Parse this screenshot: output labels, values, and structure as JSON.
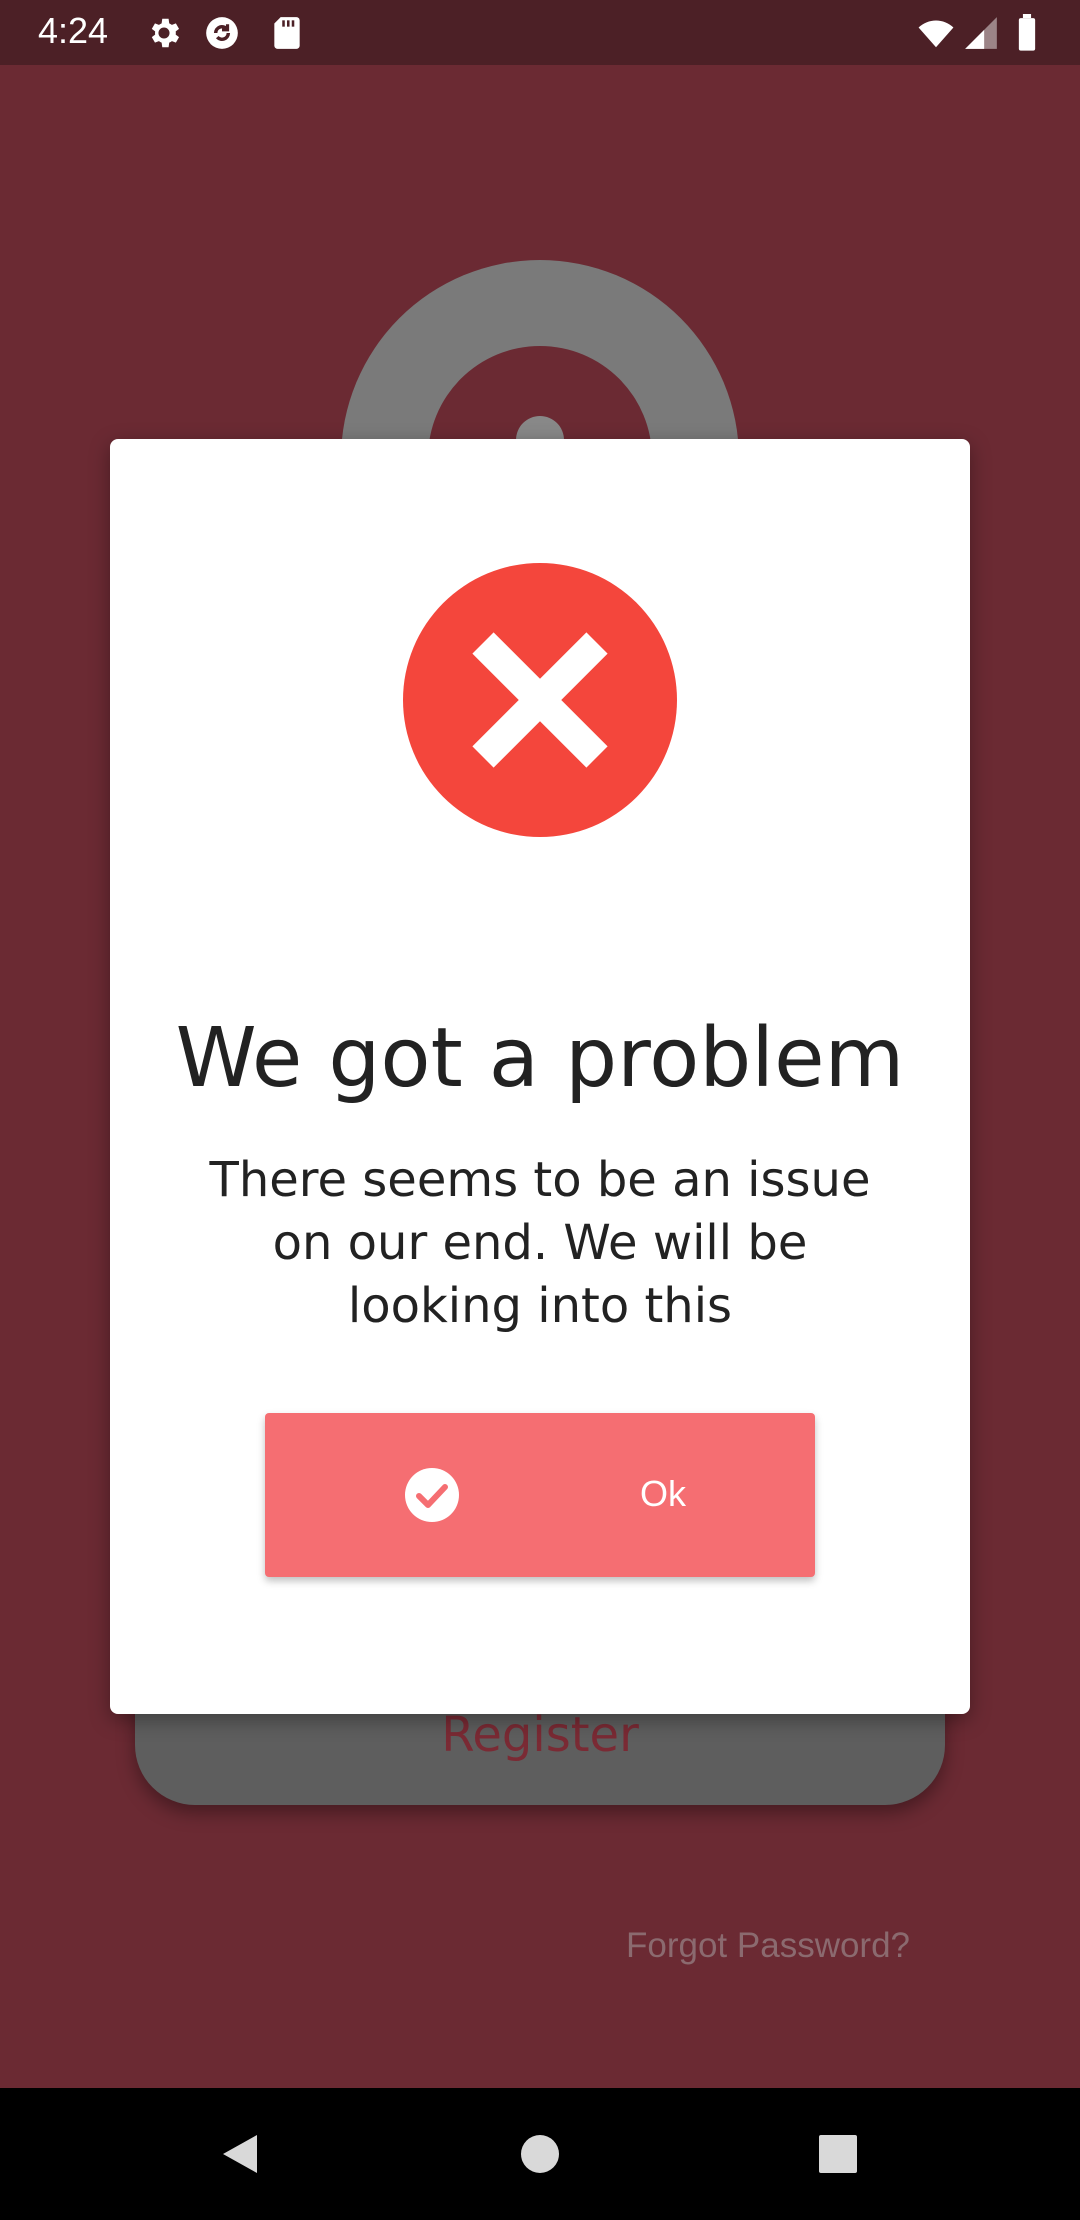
{
  "status_bar": {
    "time": "4:24",
    "icons": [
      "gear-icon",
      "sync-icon",
      "sd-card-icon",
      "wifi-icon",
      "signal-icon",
      "battery-icon"
    ]
  },
  "background_screen": {
    "register_label": "Register",
    "forgot_password": "Forgot Password?"
  },
  "dialog": {
    "icon": "error-x-icon",
    "title": "We got a problem",
    "message": "There seems to be an issue on our end. We will be looking into this",
    "ok_button": {
      "label": "Ok",
      "icon": "check-circle-icon"
    }
  },
  "nav_bar": {
    "icons": [
      "back-icon",
      "home-icon",
      "recents-icon"
    ]
  },
  "colors": {
    "app_background": "#6b2a33",
    "status_bar": "#4c2026",
    "error_red": "#f4463c",
    "ok_button": "#f56e72"
  }
}
